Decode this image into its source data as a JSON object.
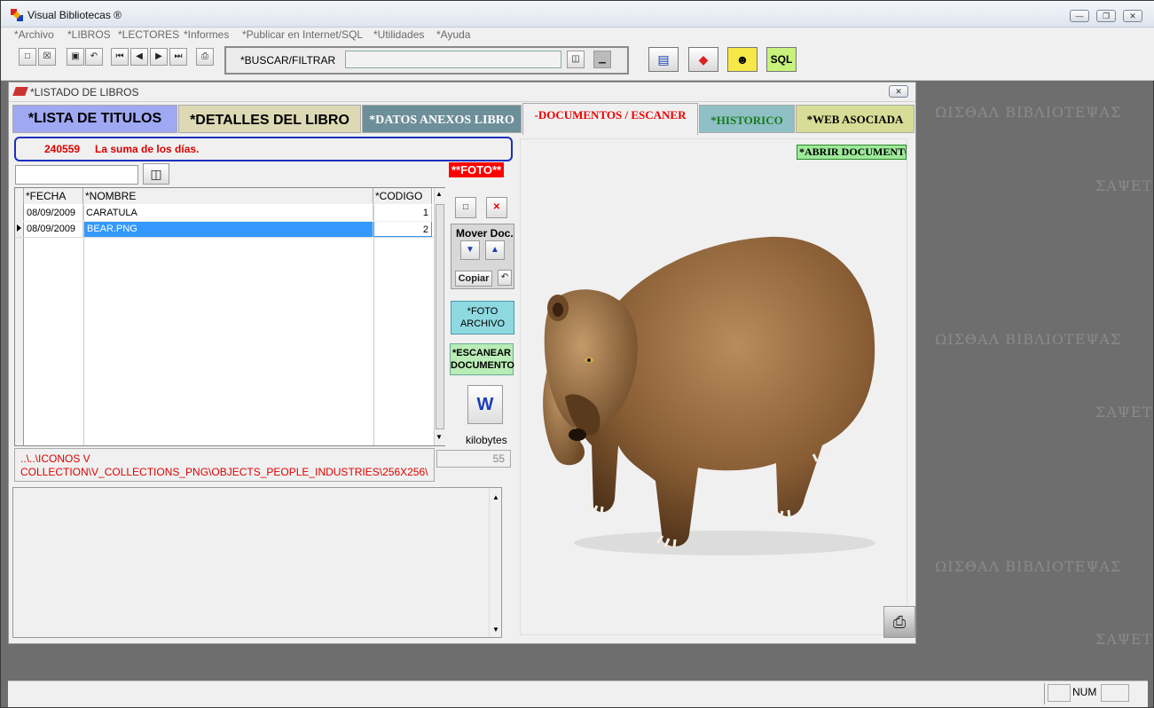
{
  "window": {
    "title": "Visual Bibliotecas ®",
    "minimize": "—",
    "restore": "❐",
    "close": "✕"
  },
  "menu": [
    "*Archivo",
    "*LIBROS",
    "*LECTORES",
    "*Informes",
    "*Publicar en Internet/SQL",
    "*Utilidades",
    "*Ayuda"
  ],
  "toolbar": {
    "search_label": "*BUSCAR/FILTRAR",
    "search_value": "",
    "sql_label": "SQL"
  },
  "child": {
    "title": "*LISTADO DE LIBROS",
    "close": "✕"
  },
  "tabs": [
    {
      "label": "*LISTA DE TITULOS",
      "bg": "#9fa8f2",
      "color": "#000"
    },
    {
      "label": "*DETALLES DEL LIBRO",
      "bg": "#ddd9b4",
      "color": "#000"
    },
    {
      "label": "*DATOS ANEXOS LIBRO",
      "bg": "#6d8f99",
      "color": "#ffffff"
    },
    {
      "label": "-DOCUMENTOS / ESCANER",
      "bg": "#f0f0f0",
      "color": "#e00000"
    },
    {
      "label": "*HISTORICO",
      "bg": "#8fc0c6",
      "color": "#1a7a1a"
    },
    {
      "label": "*WEB ASOCIADA",
      "bg": "#d7dd96",
      "color": "#000"
    }
  ],
  "record": {
    "id": "240559",
    "title": "La suma de los días."
  },
  "filter": {
    "value": ""
  },
  "foto_label": "**FOTO**",
  "grid": {
    "headers": [
      "*FECHA",
      "*NOMBRE",
      "*CODIGO"
    ],
    "rows": [
      {
        "fecha": "08/09/2009",
        "nombre": "CARATULA",
        "codigo": "1"
      },
      {
        "fecha": "08/09/2009",
        "nombre": "BEAR.PNG",
        "codigo": "2"
      }
    ]
  },
  "side": {
    "mover_label": "Mover Doc.",
    "copiar_label": "Copiar",
    "foto_archivo_line1": "*FOTO",
    "foto_archivo_line2": "ARCHIVO",
    "escanear_line1": "*ESCANEAR",
    "escanear_line2": "DOCUMENTO",
    "kilobytes_label": "kilobytes",
    "kilobytes_value": "55"
  },
  "path": {
    "line1": "..\\..\\ICONOS V",
    "line2": "COLLECTION\\V_COLLECTIONS_PNG\\OBJECTS_PEOPLE_INDUSTRIES\\256X256\\"
  },
  "photo": {
    "open_label": "*ABRIR DOCUMENTO"
  },
  "watermarks": [
    "ΩΙΣΘΑΛ ΒΙΒΛΙΟΤΕΨΑΣ",
    "ΣΑΨΕΤ",
    "ΩΙΣΘΑΛ ΒΙΒΛΙΟΤΕΨΑΣ",
    "ΣΑΨΕΤ",
    "ΩΙΣΘΑΛ ΒΙΒΛΙΟΤΕΨΑΣ",
    "ΣΑΨΕΤ"
  ],
  "status": {
    "num": "NUM"
  }
}
